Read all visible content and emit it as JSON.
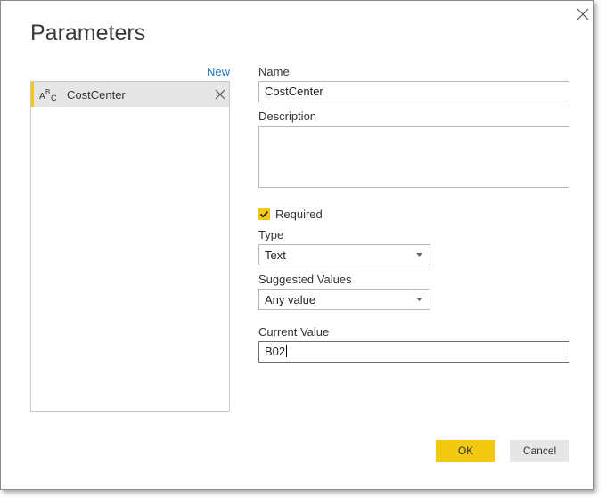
{
  "dialog": {
    "title": "Parameters",
    "close_icon": "close-icon"
  },
  "sidebar": {
    "new_label": "New",
    "items": [
      {
        "label": "CostCenter",
        "type_icon": "text-type-icon",
        "remove_icon": "remove-icon",
        "selected": true
      }
    ]
  },
  "form": {
    "name_label": "Name",
    "name_value": "CostCenter",
    "description_label": "Description",
    "description_value": "",
    "required_label": "Required",
    "required_checked": true,
    "type_label": "Type",
    "type_value": "Text",
    "suggested_label": "Suggested Values",
    "suggested_value": "Any value",
    "current_label": "Current Value",
    "current_value": "B02"
  },
  "buttons": {
    "ok_label": "OK",
    "cancel_label": "Cancel"
  },
  "colors": {
    "accent": "#f2c811",
    "link": "#1e77c9",
    "selected_bg": "#e6e6e6"
  }
}
